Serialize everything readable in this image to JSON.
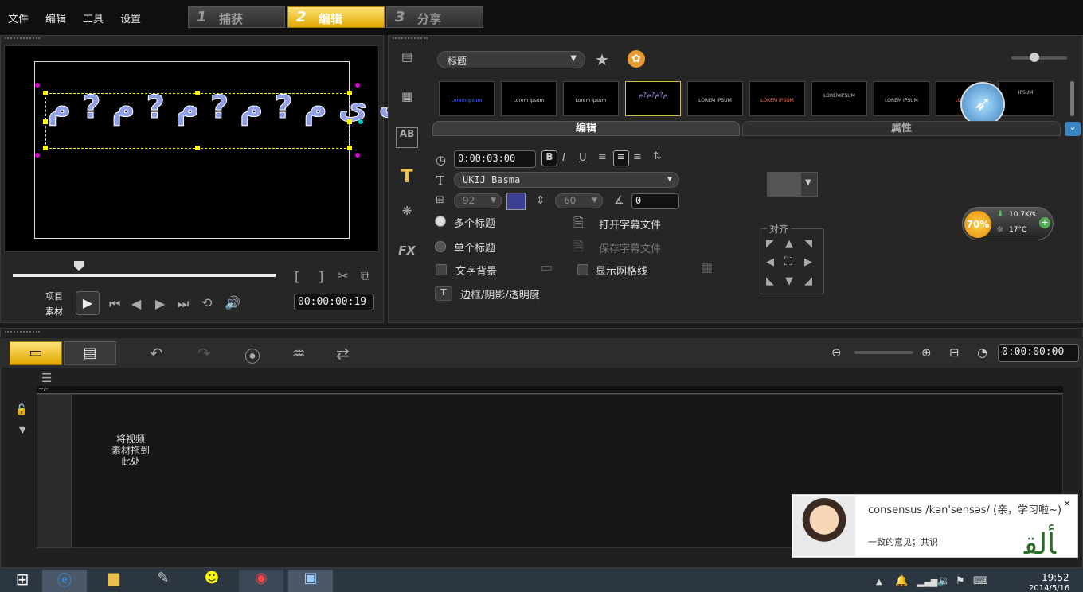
{
  "menu": {
    "file": "文件",
    "edit": "编辑",
    "tools": "工具",
    "settings": "设置"
  },
  "steps": [
    {
      "num": "1",
      "label": "捕获"
    },
    {
      "num": "2",
      "label": "编辑"
    },
    {
      "num": "3",
      "label": "分享"
    }
  ],
  "preview": {
    "sample_text": "ی ق ك ? ب ی م ? م ? م ? م ? م",
    "mode_project": "项目",
    "mode_clip": "素材",
    "timecode": "00:00:00:19"
  },
  "library": {
    "category": "标题"
  },
  "thumbnails": [
    "Lorem ipsum",
    "Lorem ipsum",
    "Lorem ipsum",
    "م?م?م?م",
    "LOREM IPSUM",
    "LOREM IPSUM",
    "LOREMIPSUM",
    "LOREM IPSUM",
    "LOREM",
    "IPSUM"
  ],
  "options": {
    "tab_edit": "编辑",
    "tab_props": "属性",
    "duration": "0:00:03:00",
    "font": "UKIJ Basma",
    "font_size": "92",
    "line_spacing": "60",
    "rotation": "0",
    "multi_title": "多个标题",
    "single_title": "单个标题",
    "open_subtitle": "打开字幕文件",
    "save_subtitle": "保存字幕文件",
    "text_bg": "文字背景",
    "show_grid": "显示网格线",
    "border_shadow": "边框/阴影/透明度",
    "align": "对齐",
    "text_color": "#3b3f94"
  },
  "widget": {
    "percent": "70%",
    "speed": "10.7K/s",
    "temp": "17°C"
  },
  "timeline": {
    "timecode": "0:00:00:00",
    "drop_hint": "将视频\n素材拖到\n此处",
    "add_remove": "+/-"
  },
  "dict": {
    "word": "consensus /kən'sensəs/ (亲，学习啦~)",
    "meaning": "一致的意见；共识"
  },
  "tray": {
    "time": "19:52",
    "date": "2014/5/16"
  }
}
